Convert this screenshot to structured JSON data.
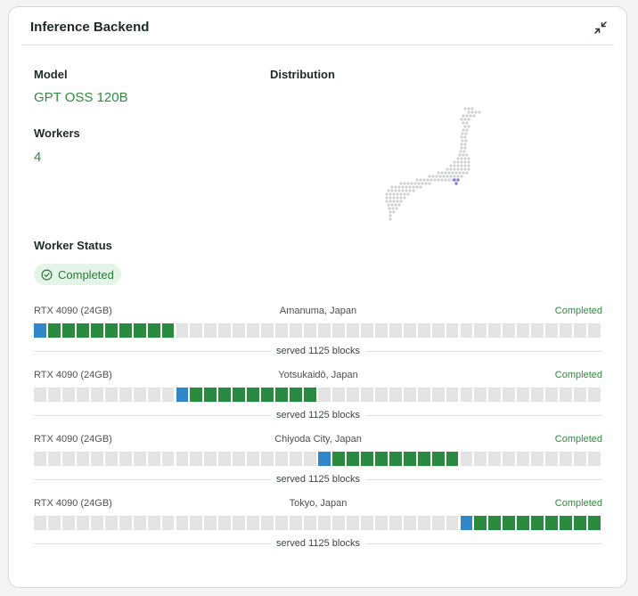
{
  "header": {
    "title": "Inference Backend",
    "collapse_icon": "collapse-icon"
  },
  "model": {
    "label": "Model",
    "value": "GPT OSS 120B"
  },
  "workers": {
    "label": "Workers",
    "value": "4"
  },
  "distribution": {
    "label": "Distribution",
    "map": "japan-dot-map"
  },
  "worker_status": {
    "label": "Worker Status",
    "badge": "Completed",
    "badge_icon": "check-circle-icon"
  },
  "colors": {
    "accent": "#2e8b3e",
    "active_block": "#2f86c8",
    "done_block": "#2a8a3e",
    "empty_block": "#e3e3e3"
  },
  "worker_list": [
    {
      "gpu": "RTX 4090 (24GB)",
      "location": "Amanuma, Japan",
      "status": "Completed",
      "served": "served 1125 blocks",
      "total_blocks": 40,
      "active_block": 1,
      "done_range": [
        2,
        10
      ]
    },
    {
      "gpu": "RTX 4090 (24GB)",
      "location": "Yotsukaidō, Japan",
      "status": "Completed",
      "served": "served 1125 blocks",
      "total_blocks": 40,
      "active_block": 11,
      "done_range": [
        12,
        20
      ]
    },
    {
      "gpu": "RTX 4090 (24GB)",
      "location": "Chiyoda City, Japan",
      "status": "Completed",
      "served": "served 1125 blocks",
      "total_blocks": 40,
      "active_block": 21,
      "done_range": [
        22,
        30
      ]
    },
    {
      "gpu": "RTX 4090 (24GB)",
      "location": "Tokyo, Japan",
      "status": "Completed",
      "served": "served 1125 blocks",
      "total_blocks": 40,
      "active_block": 31,
      "done_range": [
        32,
        40
      ]
    }
  ]
}
